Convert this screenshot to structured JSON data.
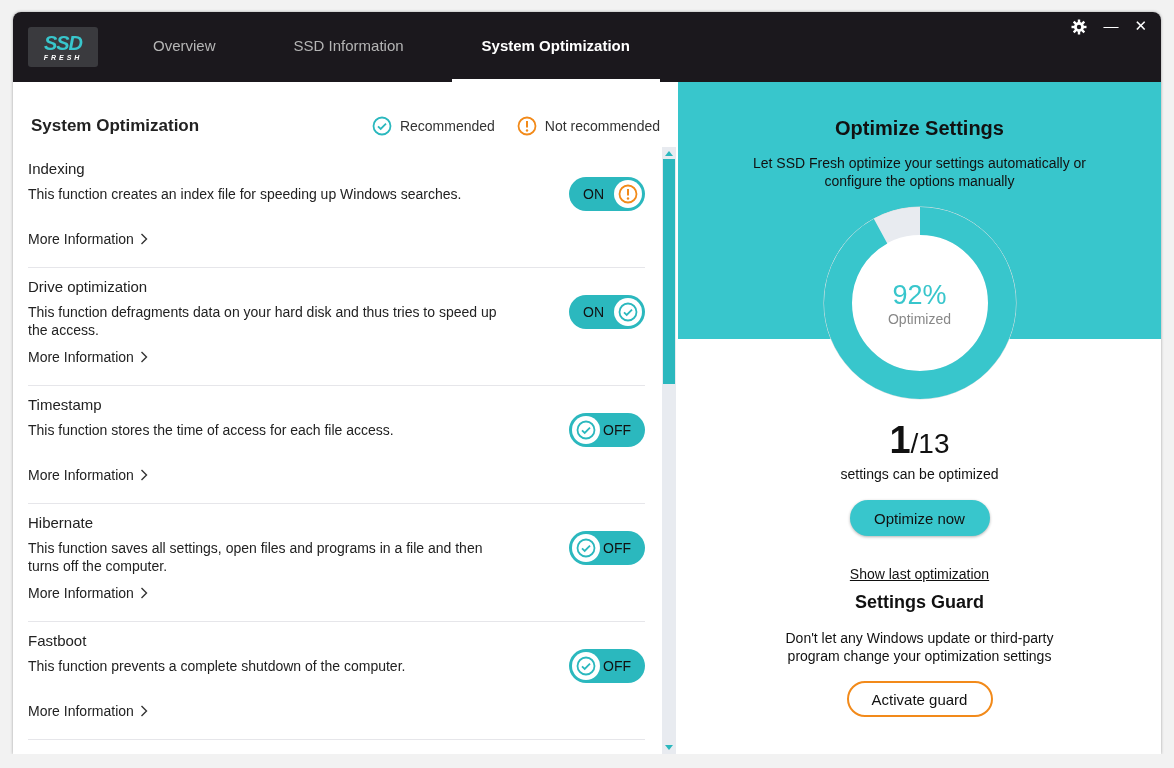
{
  "logo": {
    "top": "SSD",
    "bottom": "FRESH"
  },
  "tabs": [
    {
      "label": "Overview",
      "selected": false
    },
    {
      "label": "SSD Information",
      "selected": false
    },
    {
      "label": "System Optimization",
      "selected": true
    }
  ],
  "window_controls": {
    "minimize": "—",
    "close": "✕"
  },
  "left_panel": {
    "title": "System Optimization",
    "legend": [
      {
        "kind": "recommended",
        "label": "Recommended"
      },
      {
        "kind": "warning",
        "label": "Not recommended"
      }
    ],
    "items": [
      {
        "title": "Indexing",
        "description": "This function creates an index file for speeding up Windows searches.",
        "on": true,
        "kind": "warning",
        "toggle_label": "ON",
        "link": "More Information"
      },
      {
        "title": "Drive optimization",
        "description": "This function defragments data on your hard disk and thus tries to speed up the access.",
        "on": true,
        "kind": "recommended",
        "toggle_label": "ON",
        "link": "More Information"
      },
      {
        "title": "Timestamp",
        "description": "This function stores the time of access for each file access.",
        "on": false,
        "kind": "recommended",
        "toggle_label": "OFF",
        "link": "More Information"
      },
      {
        "title": "Hibernate",
        "description": "This function saves all settings, open files and programs in a file and then turns off the computer.",
        "on": false,
        "kind": "recommended",
        "toggle_label": "OFF",
        "link": "More Information"
      },
      {
        "title": "Fastboot",
        "description": "This function prevents a complete shutdown of the computer.",
        "on": false,
        "kind": "recommended",
        "toggle_label": "OFF",
        "link": "More Information"
      }
    ]
  },
  "right_panel": {
    "title": "Optimize Settings",
    "subtitle": "Let SSD Fresh optimize your settings automatically or configure the options manually",
    "gauge": {
      "level": 0.92,
      "value": "92%",
      "label": "Optimized"
    },
    "count": "1",
    "total": "/13",
    "count_caption": "settings can be optimized",
    "optimize_button": "Optimize now",
    "last_link": "Show last optimization",
    "guard_title": "Settings Guard",
    "guard_text": "Don't let any Windows update or third-party program change your optimization settings",
    "guard_button": "Activate guard"
  }
}
